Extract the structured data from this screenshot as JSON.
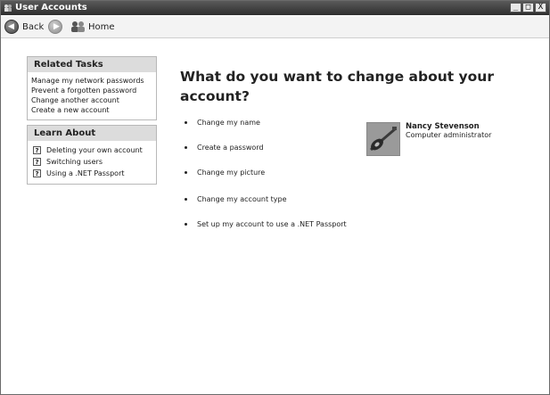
{
  "window": {
    "title": "User Accounts",
    "minimize": "_",
    "maximize": "□",
    "close": "X"
  },
  "toolbar": {
    "back": "Back",
    "home": "Home"
  },
  "related_tasks": {
    "header": "Related Tasks",
    "items": [
      "Manage my network passwords",
      "Prevent a forgotten password",
      "Change another account",
      "Create a new account"
    ]
  },
  "learn_about": {
    "header": "Learn About",
    "items": [
      "Deleting your own account",
      "Switching users",
      "Using a .NET Passport"
    ]
  },
  "main": {
    "heading": "What do you want to change about your account?",
    "options": [
      "Change my name",
      "Create a password",
      "Change my picture",
      "Change my account type",
      "Set up my account to use a .NET Passport"
    ]
  },
  "user": {
    "name": "Nancy Stevenson",
    "role": "Computer administrator"
  },
  "icons": {
    "title": "user-accounts-icon",
    "back": "back-arrow-icon",
    "forward": "forward-arrow-icon",
    "home": "home-icon",
    "help": "help-question-icon",
    "avatar": "guitar-picture"
  }
}
